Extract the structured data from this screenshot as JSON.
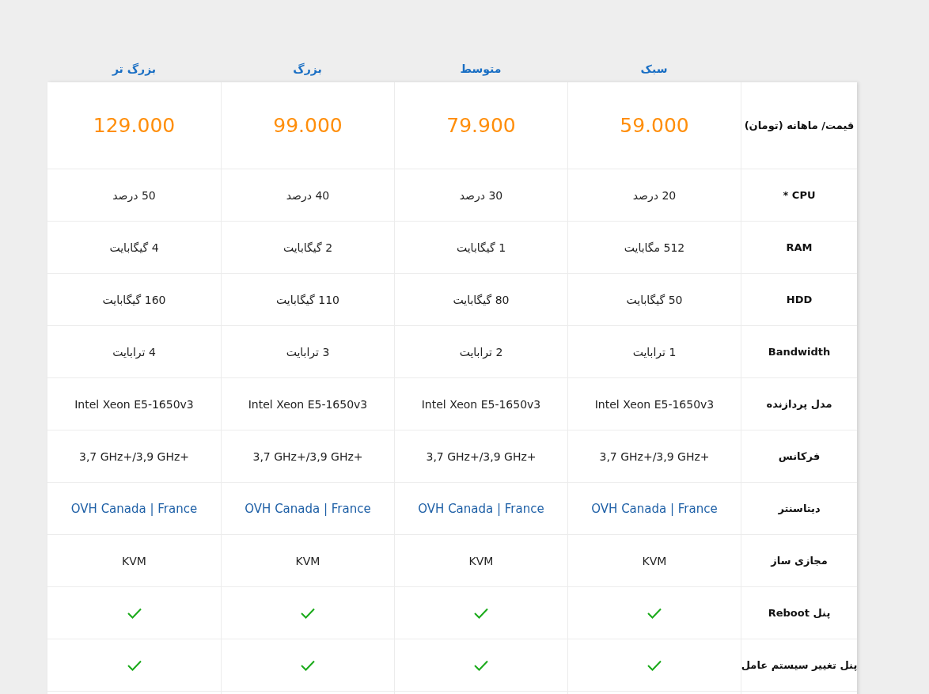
{
  "plans": [
    "سبک",
    "متوسط",
    "بزرگ",
    "بزرگ تر"
  ],
  "rows": [
    {
      "kind": "price",
      "label": "قیمت/ ماهانه (تومان)",
      "values": [
        "59.000",
        "79.900",
        "99.000",
        "129.000"
      ]
    },
    {
      "kind": "text",
      "label": "CPU *",
      "values": [
        "20 درصد",
        "30 درصد",
        "40 درصد",
        "50 درصد"
      ]
    },
    {
      "kind": "text",
      "label": "RAM",
      "values": [
        "512 مگابایت",
        "1 گیگابایت",
        "2 گیگابایت",
        "4 گیگابایت"
      ]
    },
    {
      "kind": "text",
      "label": "HDD",
      "values": [
        "50 گیگابایت",
        "80 گیگابایت",
        "110 گیگابایت",
        "160 گیگابایت"
      ]
    },
    {
      "kind": "text",
      "label": "Bandwidth",
      "values": [
        "1 ترابایت",
        "2 ترابایت",
        "3 ترابایت",
        "4 ترابایت"
      ]
    },
    {
      "kind": "ltr",
      "label": "مدل پردازنده",
      "values": [
        "Intel Xeon E5-1650v3",
        "Intel Xeon E5-1650v3",
        "Intel Xeon E5-1650v3",
        "Intel Xeon E5-1650v3"
      ]
    },
    {
      "kind": "ltr",
      "label": "فرکانس",
      "values": [
        "3,7 GHz+/3,9 GHz+",
        "3,7 GHz+/3,9 GHz+",
        "3,7 GHz+/3,9 GHz+",
        "3,7 GHz+/3,9 GHz+"
      ]
    },
    {
      "kind": "link",
      "label": "دیتاسنتر",
      "values": [
        "OVH Canada | France",
        "OVH Canada | France",
        "OVH Canada | France",
        "OVH Canada | France"
      ]
    },
    {
      "kind": "ltr",
      "label": "مجازی ساز",
      "values": [
        "KVM",
        "KVM",
        "KVM",
        "KVM"
      ]
    },
    {
      "kind": "check",
      "label": "پنل Reboot",
      "checked": [
        true,
        true,
        true,
        true
      ]
    },
    {
      "kind": "check",
      "label": "پنل تغییر سیستم عامل",
      "checked": [
        true,
        true,
        true,
        true
      ]
    }
  ]
}
